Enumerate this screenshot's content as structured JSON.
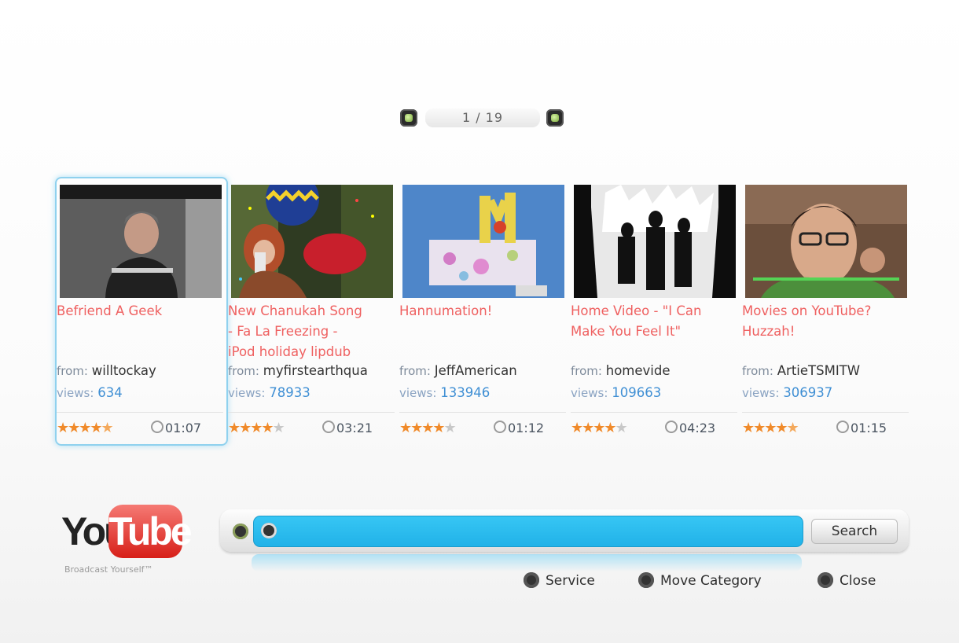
{
  "pager": {
    "text": "1 / 19"
  },
  "videos": [
    {
      "title": "Befriend A Geek",
      "from_label": "from:",
      "from": "willtockay",
      "views_label": "views:",
      "views": "634",
      "rating": 4.5,
      "duration": "01:07"
    },
    {
      "title": "New Chanukah Song\n- Fa La Freezing -\niPod holiday lipdub",
      "from_label": "from:",
      "from": "myfirstearthqua",
      "views_label": "views:",
      "views": "78933",
      "rating": 4,
      "duration": "03:21"
    },
    {
      "title": "Hannumation!",
      "from_label": "from:",
      "from": "JeffAmerican",
      "views_label": "views:",
      "views": "133946",
      "rating": 4,
      "duration": "01:12"
    },
    {
      "title": "Home Video - \"I Can\n Make You Feel It\"",
      "from_label": "from:",
      "from": "homevide",
      "views_label": "views:",
      "views": "109663",
      "rating": 4,
      "duration": "04:23"
    },
    {
      "title": "Movies on YouTube?\n Huzzah!",
      "from_label": "from:",
      "from": "ArtieTSMITW",
      "views_label": "views:",
      "views": "306937",
      "rating": 4.5,
      "duration": "01:15"
    }
  ],
  "logo": {
    "you": "You",
    "tube": "Tube",
    "tagline": "Broadcast Yourself™"
  },
  "search": {
    "value": "",
    "button": "Search"
  },
  "hints": {
    "service": "Service",
    "move_category": "Move Category",
    "close": "Close"
  },
  "colors": {
    "accent_blue": "#21b2e8",
    "title_red": "#ef6060",
    "star_orange": "#f08a2a",
    "logo_red": "#d71f18"
  }
}
